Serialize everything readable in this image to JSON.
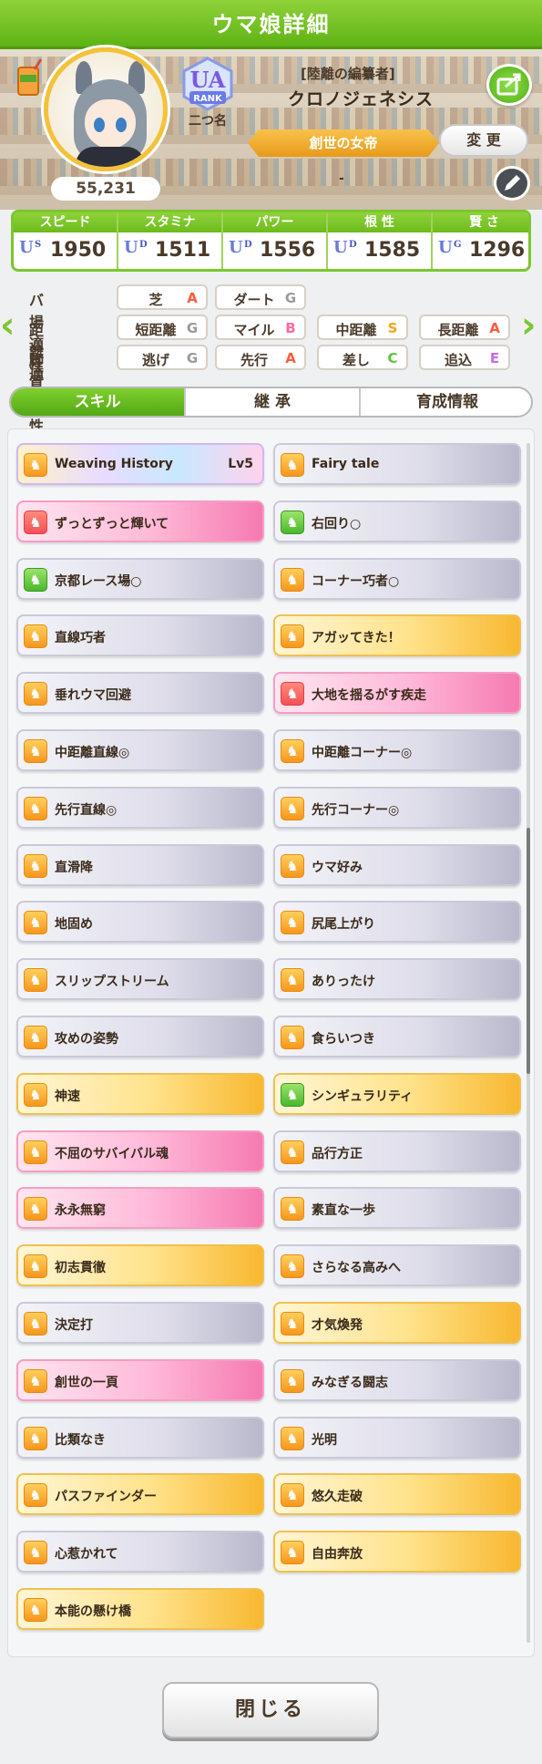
{
  "window": {
    "title": "ウマ娘詳細"
  },
  "profile": {
    "score": "55,231",
    "rank_badge": "UA",
    "rank_word": "RANK",
    "rank_name": "二つ名",
    "epithet": "[陸離の編纂者]",
    "name": "クロノジェネシス",
    "title_ribbon": "創世の女帝",
    "change_label": "変 更",
    "title_sub": "-"
  },
  "stats": [
    {
      "label": "スピード",
      "grade": "U",
      "sub": "S",
      "value": "1950"
    },
    {
      "label": "スタミナ",
      "grade": "U",
      "sub": "D",
      "value": "1511"
    },
    {
      "label": "パワー",
      "grade": "U",
      "sub": "D",
      "value": "1556"
    },
    {
      "label": "根 性",
      "grade": "U",
      "sub": "D",
      "value": "1585"
    },
    {
      "label": "賢 さ",
      "grade": "U",
      "sub": "G",
      "value": "1296"
    }
  ],
  "aptitude": {
    "track": {
      "label": "バ場適性",
      "items": [
        {
          "name": "芝",
          "grade": "A"
        },
        {
          "name": "ダート",
          "grade": "G"
        }
      ]
    },
    "distance": {
      "label": "距離適性",
      "items": [
        {
          "name": "短距離",
          "grade": "G"
        },
        {
          "name": "マイル",
          "grade": "B"
        },
        {
          "name": "中距離",
          "grade": "S"
        },
        {
          "name": "長距離",
          "grade": "A"
        }
      ]
    },
    "style": {
      "label": "脚質適性",
      "items": [
        {
          "name": "逃げ",
          "grade": "G"
        },
        {
          "name": "先行",
          "grade": "A"
        },
        {
          "name": "差し",
          "grade": "C"
        },
        {
          "name": "追込",
          "grade": "E"
        }
      ]
    }
  },
  "tabs": [
    {
      "label": "スキル"
    },
    {
      "label": "継 承"
    },
    {
      "label": "育成情報"
    }
  ],
  "skills": [
    {
      "name": "Weaving History",
      "level": "Lv5"
    },
    {
      "name": "Fairy tale"
    },
    {
      "name": "ずっとずっと輝いて"
    },
    {
      "name": "右回り○"
    },
    {
      "name": "京都レース場○"
    },
    {
      "name": "コーナー巧者○"
    },
    {
      "name": "直線巧者"
    },
    {
      "name": "アガッてきた！"
    },
    {
      "name": "垂れウマ回避"
    },
    {
      "name": "大地を揺るがす疾走"
    },
    {
      "name": "中距離直線◎"
    },
    {
      "name": "中距離コーナー◎"
    },
    {
      "name": "先行直線◎"
    },
    {
      "name": "先行コーナー◎"
    },
    {
      "name": "直滑降"
    },
    {
      "name": "ウマ好み"
    },
    {
      "name": "地固め"
    },
    {
      "name": "尻尾上がり"
    },
    {
      "name": "スリップストリーム"
    },
    {
      "name": "ありったけ"
    },
    {
      "name": "攻めの姿勢"
    },
    {
      "name": "食らいつき"
    },
    {
      "name": "神速"
    },
    {
      "name": "シンギュラリティ"
    },
    {
      "name": "不屈のサバイバル魂"
    },
    {
      "name": "品行方正"
    },
    {
      "name": "永永無窮"
    },
    {
      "name": "素直な一歩"
    },
    {
      "name": "初志貫徹"
    },
    {
      "name": "さらなる高みへ"
    },
    {
      "name": "決定打"
    },
    {
      "name": "才気煥発"
    },
    {
      "name": "創世の一頁"
    },
    {
      "name": "みなぎる闘志"
    },
    {
      "name": "比類なき"
    },
    {
      "name": "光明"
    },
    {
      "name": "パスファインダー"
    },
    {
      "name": "悠久走破"
    },
    {
      "name": "心惹かれて"
    },
    {
      "name": "自由奔放"
    },
    {
      "name": "本能の懸け橋"
    }
  ],
  "footer": {
    "close_label": "閉じる"
  }
}
